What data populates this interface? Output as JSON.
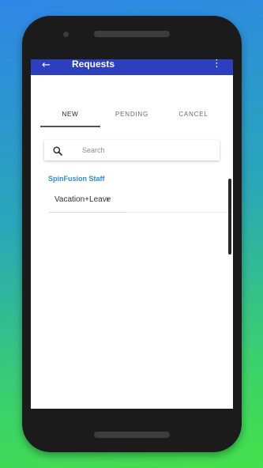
{
  "app": {
    "title": "Requests",
    "back_icon": "arrow-left-icon",
    "menu_icon": "more-vert-icon"
  },
  "tabs": [
    {
      "label": "NEW",
      "active": true
    },
    {
      "label": "PENDING",
      "active": false
    },
    {
      "label": "CANCEL",
      "active": false
    }
  ],
  "search": {
    "placeholder": "Search",
    "value": "",
    "icon": "search-icon"
  },
  "section": {
    "title": "SpinFusion Staff"
  },
  "list": [
    {
      "label": "Vacation+Leave",
      "icon": "chevron-right-icon"
    }
  ],
  "colors": {
    "appbar": "#2b3fbf",
    "section_title": "#2e8bd8",
    "background_top": "#2f86e6",
    "background_bottom": "#45e04a"
  }
}
